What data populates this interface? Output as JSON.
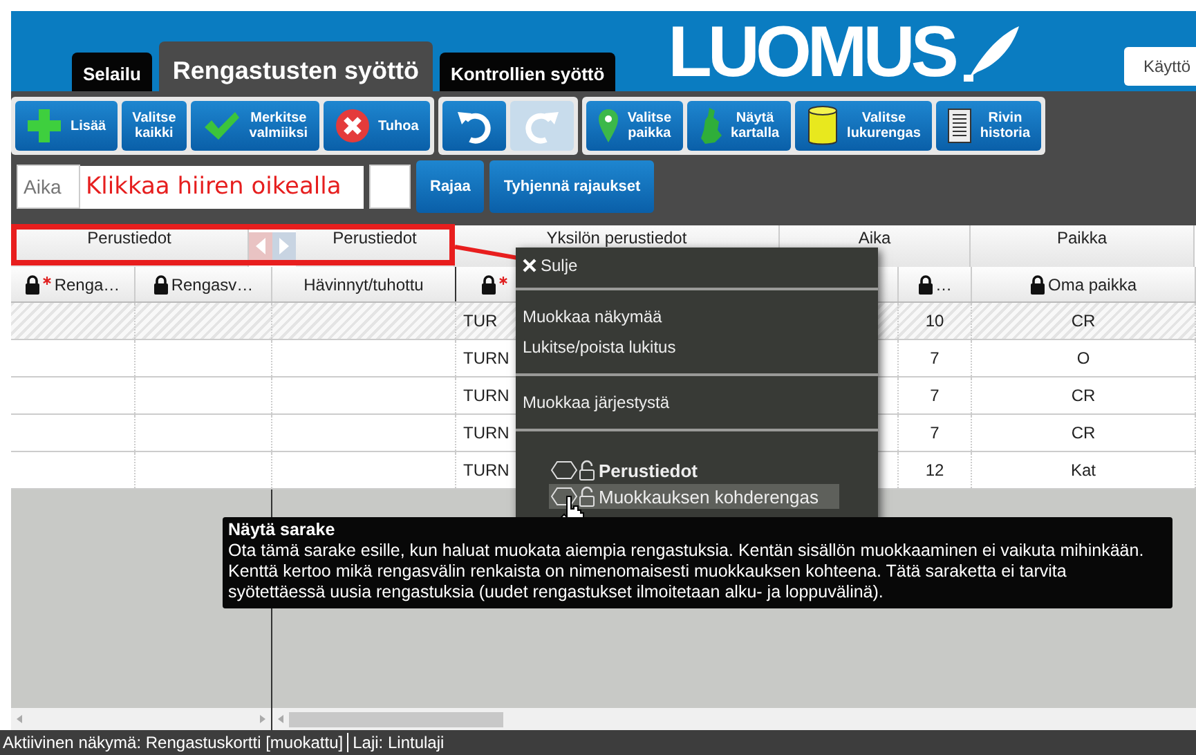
{
  "tabs": [
    {
      "label": "Selailu",
      "selected": false
    },
    {
      "label": "Rengastusten syöttö",
      "selected": true
    },
    {
      "label": "Kontrollien syöttö",
      "selected": false
    }
  ],
  "logo": "LUOMUS",
  "user_button": "Käyttö",
  "toolbar": [
    [
      {
        "kind": "add",
        "label": "Lisää",
        "disabled": false
      },
      {
        "kind": "text",
        "label": "Valitse\nkaikki",
        "disabled": false
      },
      {
        "kind": "mark",
        "label": "Merkitse\nvalmiiksi",
        "disabled": false
      },
      {
        "kind": "delete",
        "label": "Tuhoa",
        "disabled": false
      }
    ],
    [
      {
        "kind": "undo",
        "disabled": false
      },
      {
        "kind": "redo",
        "disabled": true
      }
    ],
    [
      {
        "kind": "place",
        "label": "Valitse\npaikka",
        "disabled": false
      },
      {
        "kind": "map",
        "label": "Näytä\nkartalla",
        "disabled": false
      },
      {
        "kind": "ring",
        "label": "Valitse\nlukurengas",
        "disabled": false
      },
      {
        "kind": "history",
        "label": "Rivin\nhistoria",
        "disabled": false
      }
    ]
  ],
  "filter": {
    "placeholder": "Aika",
    "limit_button": "Rajaa",
    "clear_button": "Tyhjennä rajaukset"
  },
  "annotation": "Klikkaa hiiren oikealla",
  "column_groups": [
    "Perustiedot",
    "Perustiedot",
    "Yksilön perustiedot",
    "Aika",
    "Paikka"
  ],
  "columns": [
    {
      "label": "Renga…",
      "locked": true,
      "required": true
    },
    {
      "label": "Rengasv…",
      "locked": true,
      "required": false
    },
    {
      "label": "Hävinnyt/tuhottu",
      "locked": false,
      "required": false
    },
    {
      "locked": true,
      "required": true
    },
    {
      "label": "…",
      "locked": true,
      "required": false
    },
    {
      "label": "Oma paikka",
      "locked": true,
      "required": false
    }
  ],
  "rows": [
    {
      "selected": true,
      "column_4": "TUR",
      "column_5": "10",
      "oma_paikka": "CR"
    },
    {
      "selected": false,
      "column_4": "TURN",
      "column_5": "7",
      "oma_paikka": "O"
    },
    {
      "selected": false,
      "column_4": "TURN",
      "column_5": "7",
      "oma_paikka": "CR"
    },
    {
      "selected": false,
      "column_4": "TURN",
      "column_5": "7",
      "oma_paikka": "CR"
    },
    {
      "selected": false,
      "column_4": "TURN",
      "column_5": "12",
      "oma_paikka": "Kat"
    }
  ],
  "context_menu": {
    "close": "Sulje",
    "sections": [
      [
        "Muokkaa näkymää",
        "Lukitse/poista lukitus"
      ],
      [
        "Muokkaa järjestystä"
      ]
    ],
    "column_items": [
      {
        "label": "Perustiedot",
        "kind": "group",
        "selected": false
      },
      {
        "label": "Muokkauksen kohderengas",
        "kind": "column",
        "selected": true
      }
    ]
  },
  "tooltip": {
    "title": "Näytä sarake",
    "text": "Ota tämä sarake esille, kun haluat muokata aiempia rengastuksia. Kentän sisällön muokkaaminen ei vaikuta mihinkään. Kenttä kertoo mikä rengasvälin renkaista on nimenomaisesti muokkauksen kohteena. Tätä saraketta ei tarvita syötettäessä uusia rengastuksia (uudet rengastukset ilmoitetaan alku- ja loppuvälinä)."
  },
  "status_bar": [
    "Aktiivinen näkymä: Rengastuskortti [muokattu]",
    "Laji: Lintulaji"
  ]
}
